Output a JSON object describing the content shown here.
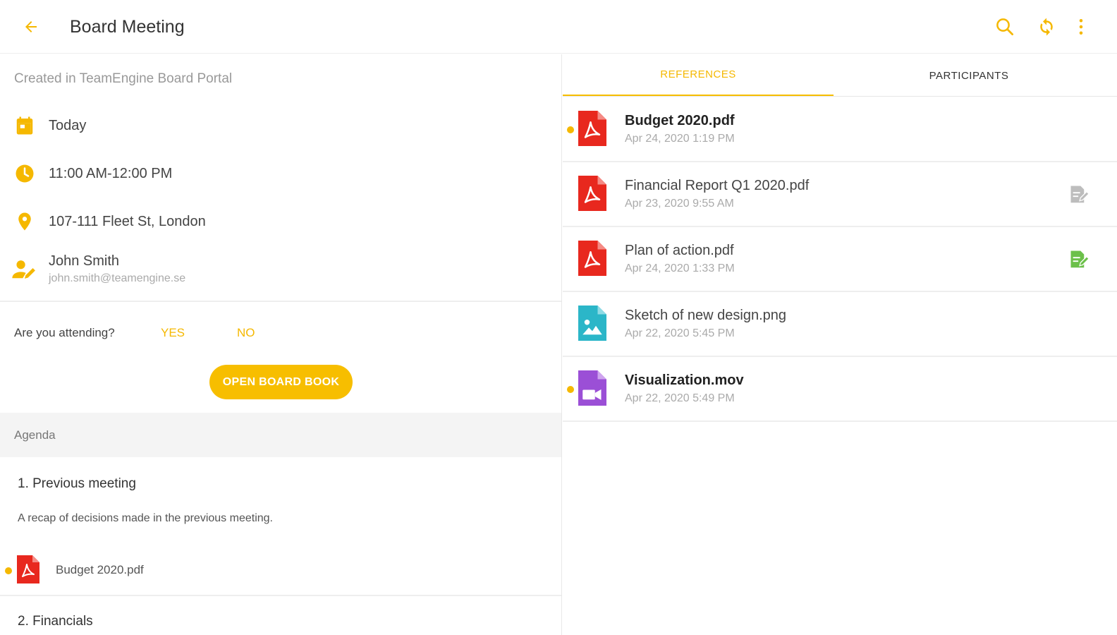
{
  "header": {
    "title": "Board Meeting",
    "icons": {
      "back": "arrow-left-icon",
      "search": "search-icon",
      "sync": "sync-icon",
      "more": "more-vertical-icon"
    },
    "accent_color": "#f5b800"
  },
  "meeting": {
    "created_in": "Created in TeamEngine Board Portal",
    "date": "Today",
    "time": "11:00 AM-12:00 PM",
    "location": "107-111 Fleet St, London",
    "organizer_name": "John Smith",
    "organizer_email": "john.smith@teamengine.se"
  },
  "attendance": {
    "question": "Are you attending?",
    "yes_label": "YES",
    "no_label": "NO",
    "open_book_label": "OPEN BOARD BOOK"
  },
  "agenda": {
    "section_label": "Agenda",
    "items": [
      {
        "title": "1. Previous meeting",
        "description": "A recap of decisions made in the previous meeting.",
        "documents": [
          {
            "name": "Budget 2020.pdf",
            "type": "pdf",
            "unread": true
          }
        ]
      },
      {
        "title": "2. Financials"
      }
    ]
  },
  "tabs": [
    {
      "label": "REFERENCES",
      "active": true
    },
    {
      "label": "PARTICIPANTS",
      "active": false
    }
  ],
  "references": [
    {
      "name": "Budget 2020.pdf",
      "date": "Apr 24, 2020 1:19 PM",
      "type": "pdf",
      "unread": true,
      "status": "none"
    },
    {
      "name": "Financial Report Q1 2020.pdf",
      "date": "Apr 23, 2020 9:55 AM",
      "type": "pdf",
      "unread": false,
      "status": "annotated-grey"
    },
    {
      "name": "Plan of action.pdf",
      "date": "Apr 24, 2020 1:33 PM",
      "type": "pdf",
      "unread": false,
      "status": "annotated-green"
    },
    {
      "name": "Sketch of new design.png",
      "date": "Apr 22, 2020 5:45 PM",
      "type": "image",
      "unread": false,
      "status": "none"
    },
    {
      "name": "Visualization.mov",
      "date": "Apr 22, 2020 5:49 PM",
      "type": "video",
      "unread": true,
      "status": "none"
    }
  ],
  "colors": {
    "pdf": "#e8281e",
    "image": "#2bb6c8",
    "video": "#9b4fd6",
    "annotated_grey": "#bdbdbd",
    "annotated_green": "#6cc04a"
  }
}
